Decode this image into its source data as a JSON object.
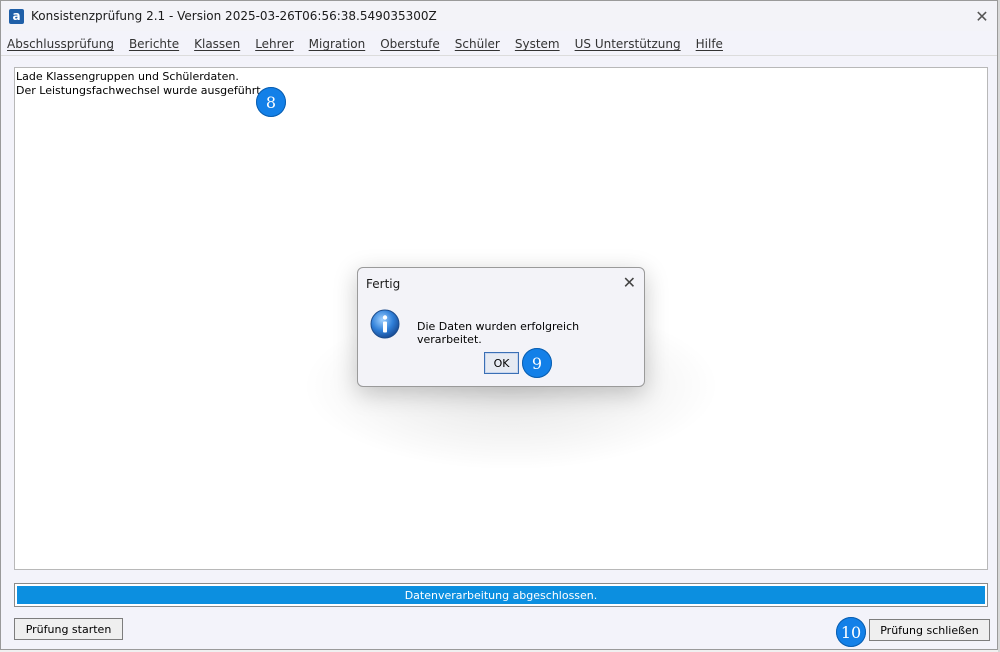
{
  "window": {
    "app_icon_glyph": "a",
    "title": "Konsistenzprüfung 2.1 - Version 2025-03-26T06:56:38.549035300Z",
    "close_glyph": "✕"
  },
  "menu": {
    "items": [
      {
        "label": "Abschlussprüfung"
      },
      {
        "label": "Berichte"
      },
      {
        "label": "Klassen"
      },
      {
        "label": "Lehrer"
      },
      {
        "label": "Migration"
      },
      {
        "label": "Oberstufe"
      },
      {
        "label": "Schüler"
      },
      {
        "label": "System"
      },
      {
        "label": "US Unterstützung"
      },
      {
        "label": "Hilfe"
      }
    ]
  },
  "log": {
    "lines": [
      "Lade Klassengruppen und Schülerdaten.",
      "Der Leistungsfachwechsel wurde ausgeführt."
    ]
  },
  "badges": {
    "log": "8",
    "ok": "9",
    "close": "10",
    "color": "#1380e8"
  },
  "progress": {
    "text": "Datenverarbeitung abgeschlossen.",
    "value_percent": 100,
    "color": "#0c8fe0"
  },
  "buttons": {
    "start": "Prüfung starten",
    "close": "Prüfung schließen"
  },
  "dialog": {
    "title": "Fertig",
    "close_glyph": "✕",
    "icon": "info-icon",
    "message": "Die Daten wurden erfolgreich verarbeitet.",
    "ok": "OK"
  }
}
